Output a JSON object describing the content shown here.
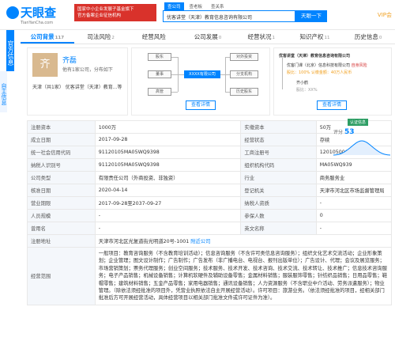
{
  "header": {
    "logo": "天眼查",
    "logo_sub": "TianYanCha.com",
    "gov_banner_line1": "国家中小企业发展子基金旗下",
    "gov_banner_line2": "官方备案企业征信机构",
    "search_tabs": [
      "查公司",
      "查老板",
      "查关系"
    ],
    "search_value": "优客讲堂（天津）教育信息咨询有限公司",
    "search_button": "天眼一下",
    "vip": "VIP会"
  },
  "side": {
    "a": "官方信息",
    "b": "自主信息"
  },
  "tabs": [
    {
      "label": "公司背景",
      "count": "117"
    },
    {
      "label": "司法风险",
      "count": "2"
    },
    {
      "label": "经营风险",
      "count": ""
    },
    {
      "label": "公司发展",
      "count": "0"
    },
    {
      "label": "经营状况",
      "count": "1"
    },
    {
      "label": "知识产权",
      "count": "11"
    },
    {
      "label": "历史信息",
      "count": "0"
    }
  ],
  "person": {
    "avatar": "齐",
    "name": "齐磊",
    "desc": "他有1家公司，分布如下",
    "role": "天津（共1家）    优客讲堂（天津）教育...等"
  },
  "equity": {
    "nodes": [
      "股东",
      "对外投资",
      "董事",
      "XXXX有限公司",
      "分支机构",
      "高管",
      "历史股东"
    ],
    "button": "查看详情"
  },
  "risk": {
    "company": "优客讲堂（天津）教育信息咨询有限公司",
    "line1": "优客门课（北京）信息科技有限公司",
    "line1_tag": "自身风险",
    "line2": "股比：100%",
    "line2_tag": "认缴金额：40万人民币",
    "line3": "齐小鹤",
    "line4": "股比：XX%",
    "button": "查看详情"
  },
  "score": {
    "tag": "认证信息",
    "label": "评分",
    "value": "53"
  },
  "table": {
    "rows": [
      [
        "注册资本",
        "1000万",
        "实缴资本",
        "50万"
      ],
      [
        "成立日期",
        "2017-09-28",
        "经营状态",
        "存续"
      ],
      [
        "统一社会信用代码",
        "91120105MA05WQ9398",
        "工商注册号",
        "120105000248838"
      ],
      [
        "纳税人识别号",
        "91120105MA05WQ9398",
        "组织机构代码",
        "MA05WQ939"
      ],
      [
        "公司类型",
        "有限责任公司（外商投资、非独资）",
        "行业",
        "商务服务业"
      ],
      [
        "核准日期",
        "2020-04-14",
        "登记机关",
        "天津市河北区市场监督管理局"
      ],
      [
        "营业期限",
        "2017-09-28至2037-09-27",
        "纳税人资质",
        "-"
      ],
      [
        "人员规模",
        "-",
        "参保人数",
        "0"
      ],
      [
        "曾用名",
        "-",
        "英文名称",
        "-"
      ]
    ],
    "address_label": "注册地址",
    "address": "天津市河北区光复道街光明道20号-1001",
    "address_link": "附近公司",
    "scope_label": "经营范围",
    "scope": "一般项目：教育咨询服务（不含教育培训活动）；信息咨询服务（不含许可类信息咨询服务）；组织文化艺术交流活动；企业形象策划；企业管理；图文设计制作；广告制作；广告发布（非广播电台、电视台、报刊出版单位）；广告设计、代理；会议及展览服务；市场营销策划；票务代理服务；创业空间服务；技术服务、技术开发、技术咨询、技术交流、技术转让、技术推广；信息技术咨询服务；电子产品销售；机械设备销售；计算机软硬件及辅助设备零售；金属材料销售；服装服饰零售；针纺织品销售；日用品零售；鞋帽零售；建筑材料销售；五金产品零售；家用电器销售；通讯设备销售；人力资源服务（不含职业中介活动、劳务派遣服务）；物业管理。（除依法须经批准的项目外，凭营业执照依法自主开展经营活动）。许可项目：旅游业务。（依法须经批准的项目，经相关部门批准后方可开展经营活动，具体经营项目以相关部门批准文件或许可证件为准）。"
  }
}
